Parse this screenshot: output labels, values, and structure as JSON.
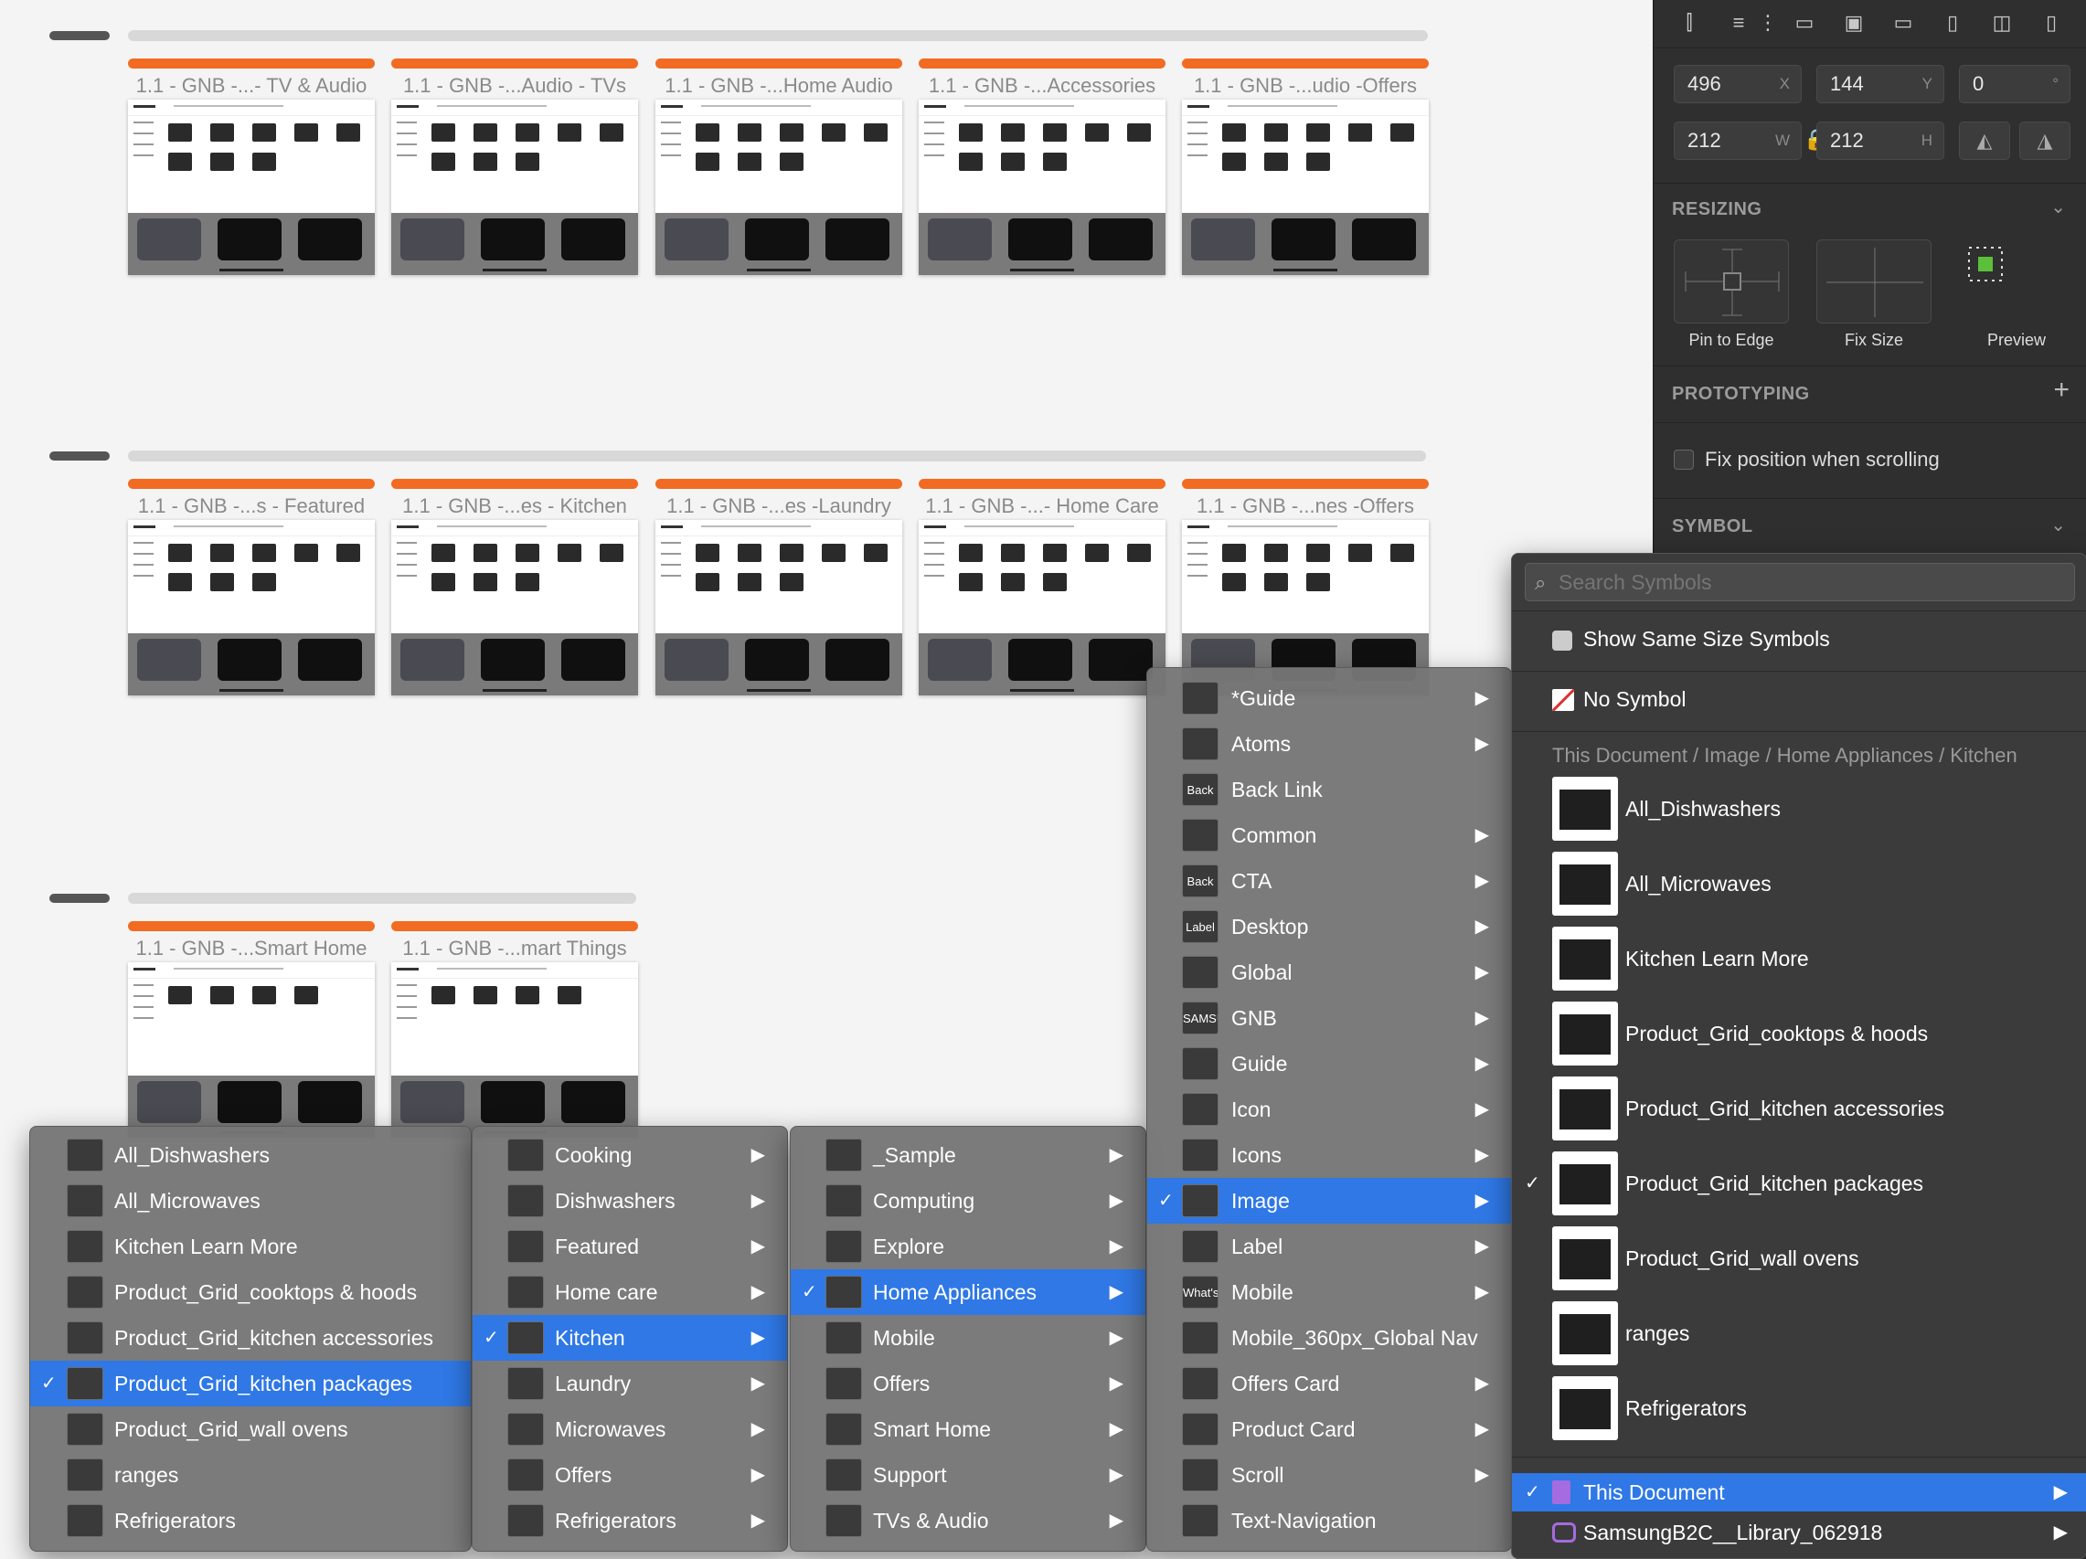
{
  "canvas": {
    "rows": [
      {
        "artboards": [
          "1.1 - GNB -...- TV & Audio",
          "1.1 - GNB -...Audio - TVs",
          "1.1 - GNB -...Home Audio",
          "1.1 - GNB -...Accessories",
          "1.1 - GNB -...udio -Offers"
        ]
      },
      {
        "artboards": [
          "1.1 - GNB -...s - Featured",
          "1.1 - GNB -...es - Kitchen",
          "1.1 - GNB -...es -Laundry",
          "1.1 - GNB -...- Home Care",
          "1.1 - GNB -...nes -Offers"
        ]
      },
      {
        "artboards": [
          "1.1 - GNB -...Smart Home",
          "1.1 - GNB -...mart Things"
        ]
      }
    ]
  },
  "inspector": {
    "x": "496",
    "x_unit": "X",
    "y": "144",
    "y_unit": "Y",
    "rotation": "0",
    "rotation_unit": "°",
    "w": "212",
    "w_unit": "W",
    "h": "212",
    "h_unit": "H",
    "resizing_title": "RESIZING",
    "resizing_options": [
      "Pin to Edge",
      "Fix Size",
      "Preview"
    ],
    "prototyping_title": "PROTOTYPING",
    "fix_position": "Fix position when scrolling",
    "symbol_title": "SYMBOL"
  },
  "symbol_menu": {
    "search_placeholder": "Search Symbols",
    "show_same_size": "Show Same Size Symbols",
    "no_symbol": "No Symbol",
    "breadcrumb": "This Document / Image / Home Appliances / Kitchen",
    "items": [
      "All_Dishwashers",
      "All_Microwaves",
      "Kitchen Learn More",
      "Product_Grid_cooktops & hoods",
      "Product_Grid_kitchen accessories",
      "Product_Grid_kitchen packages",
      "Product_Grid_wall ovens",
      "ranges",
      "Refrigerators"
    ],
    "checked_item": "Product_Grid_kitchen packages",
    "libraries": [
      "This Document",
      "SamsungB2C__Library_062918"
    ]
  },
  "menu_pages": {
    "items": [
      "*Guide",
      "Atoms",
      "Back Link",
      "Common",
      "CTA",
      "Desktop",
      "Global",
      "GNB",
      "Guide",
      "Icon",
      "Icons",
      "Image",
      "Label",
      "Mobile",
      "Mobile_360px_Global Nav",
      "Offers Card",
      "Product Card",
      "Scroll",
      "Text-Navigation"
    ],
    "icon_text": [
      "",
      "",
      "Back",
      "",
      "Back",
      "Label",
      "",
      "SAMSUNG",
      "",
      "",
      "",
      "",
      "",
      "What's new",
      "",
      "",
      "",
      "",
      ""
    ],
    "selected": "Image"
  },
  "menu_categories": {
    "items": [
      "_Sample",
      "Computing",
      "Explore",
      "Home Appliances",
      "Mobile",
      "Offers",
      "Smart Home",
      "Support",
      "TVs & Audio"
    ],
    "selected": "Home Appliances"
  },
  "menu_kitchen": {
    "items": [
      "Cooking",
      "Dishwashers",
      "Featured",
      "Home care",
      "Kitchen",
      "Laundry",
      "Microwaves",
      "Offers",
      "Refrigerators"
    ],
    "selected": "Kitchen"
  },
  "menu_symbols": {
    "items": [
      "All_Dishwashers",
      "All_Microwaves",
      "Kitchen Learn More",
      "Product_Grid_cooktops & hoods",
      "Product_Grid_kitchen accessories",
      "Product_Grid_kitchen packages",
      "Product_Grid_wall ovens",
      "ranges",
      "Refrigerators"
    ],
    "selected": "Product_Grid_kitchen packages"
  },
  "colors": {
    "accent_selection": "#2f78e5",
    "artboard_tab": "#f26b22",
    "inspector_bg": "#2f2f2f"
  }
}
